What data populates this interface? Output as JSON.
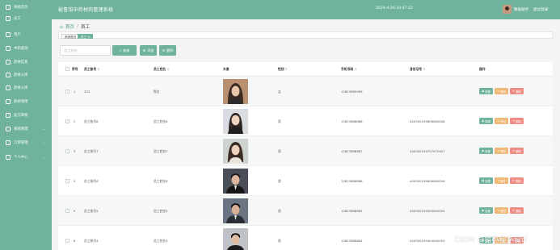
{
  "header": {
    "app_title": "秘鲁馆中药材的管理系统",
    "datetime": "2024-4-26 10:47:22",
    "user_name": "数据助手",
    "logout": "退出登录"
  },
  "sidebar": {
    "items": [
      {
        "label": "系统首页",
        "icon": "home-icon",
        "has_children": false
      },
      {
        "label": "员工",
        "icon": "user-icon",
        "has_children": false
      },
      {
        "label": "用户",
        "icon": "users-icon",
        "has_children": false
      },
      {
        "label": "中药类别",
        "icon": "category-icon",
        "has_children": false
      },
      {
        "label": "药材信息",
        "icon": "herb-icon",
        "has_children": false
      },
      {
        "label": "药材入库",
        "icon": "inbox-icon",
        "has_children": false
      },
      {
        "label": "药材入库",
        "icon": "inbox-icon",
        "has_children": false
      },
      {
        "label": "药材领用",
        "icon": "outbox-icon",
        "has_children": false
      },
      {
        "label": "处方审核",
        "icon": "check-icon",
        "has_children": false
      },
      {
        "label": "系统管理",
        "icon": "settings-icon",
        "has_children": true
      },
      {
        "label": "订单管理",
        "icon": "order-icon",
        "has_children": true
      },
      {
        "label": "个人中心",
        "icon": "profile-icon",
        "has_children": true
      }
    ]
  },
  "breadcrumb": {
    "home": "首页",
    "separator": "/",
    "current": "员工"
  },
  "tags": [
    {
      "label": "系统首页",
      "active": false
    },
    {
      "label": "员工 ×",
      "active": true
    }
  ],
  "toolbar": {
    "search_placeholder": "员工姓名",
    "search_label": "查询",
    "add_label": "添加",
    "delete_label": "删除"
  },
  "table": {
    "headers": [
      "序号",
      "员工账号",
      "员工姓名",
      "头像",
      "性别",
      "手机号码",
      "身份证号",
      "操作"
    ],
    "rows": [
      {
        "index": "1",
        "account": "222",
        "name": "陈红",
        "gender": "女",
        "phone": "13823889999",
        "id_card": "",
        "photo": "female"
      },
      {
        "index": "2",
        "account": "员工账号8",
        "name": "员工姓名8",
        "gender": "男",
        "phone": "13823888888",
        "id_card": "440300199808080008",
        "photo": "female2"
      },
      {
        "index": "3",
        "account": "员工账号7",
        "name": "员工姓名7",
        "gender": "男",
        "phone": "13823888887",
        "id_card": "440300199707070007",
        "photo": "female3"
      },
      {
        "index": "4",
        "account": "员工账号6",
        "name": "员工姓名6",
        "gender": "男",
        "phone": "13823888886",
        "id_card": "440300199606060006",
        "photo": "male"
      },
      {
        "index": "5",
        "account": "员工账号5",
        "name": "员工姓名5",
        "gender": "男",
        "phone": "13823888885",
        "id_card": "440300199505050005",
        "photo": "male2"
      },
      {
        "index": "6",
        "account": "员工账号4",
        "name": "员工姓名4",
        "gender": "男",
        "phone": "13823888884",
        "id_card": "440300199404040004",
        "photo": "male3"
      }
    ],
    "actions": {
      "view": "查看",
      "edit": "修改",
      "delete": "删除"
    }
  },
  "watermark": "CSDN @猿码程序设计",
  "colors": {
    "primary": "#6fb39e",
    "warning": "#f0b877",
    "danger": "#f08c83"
  }
}
